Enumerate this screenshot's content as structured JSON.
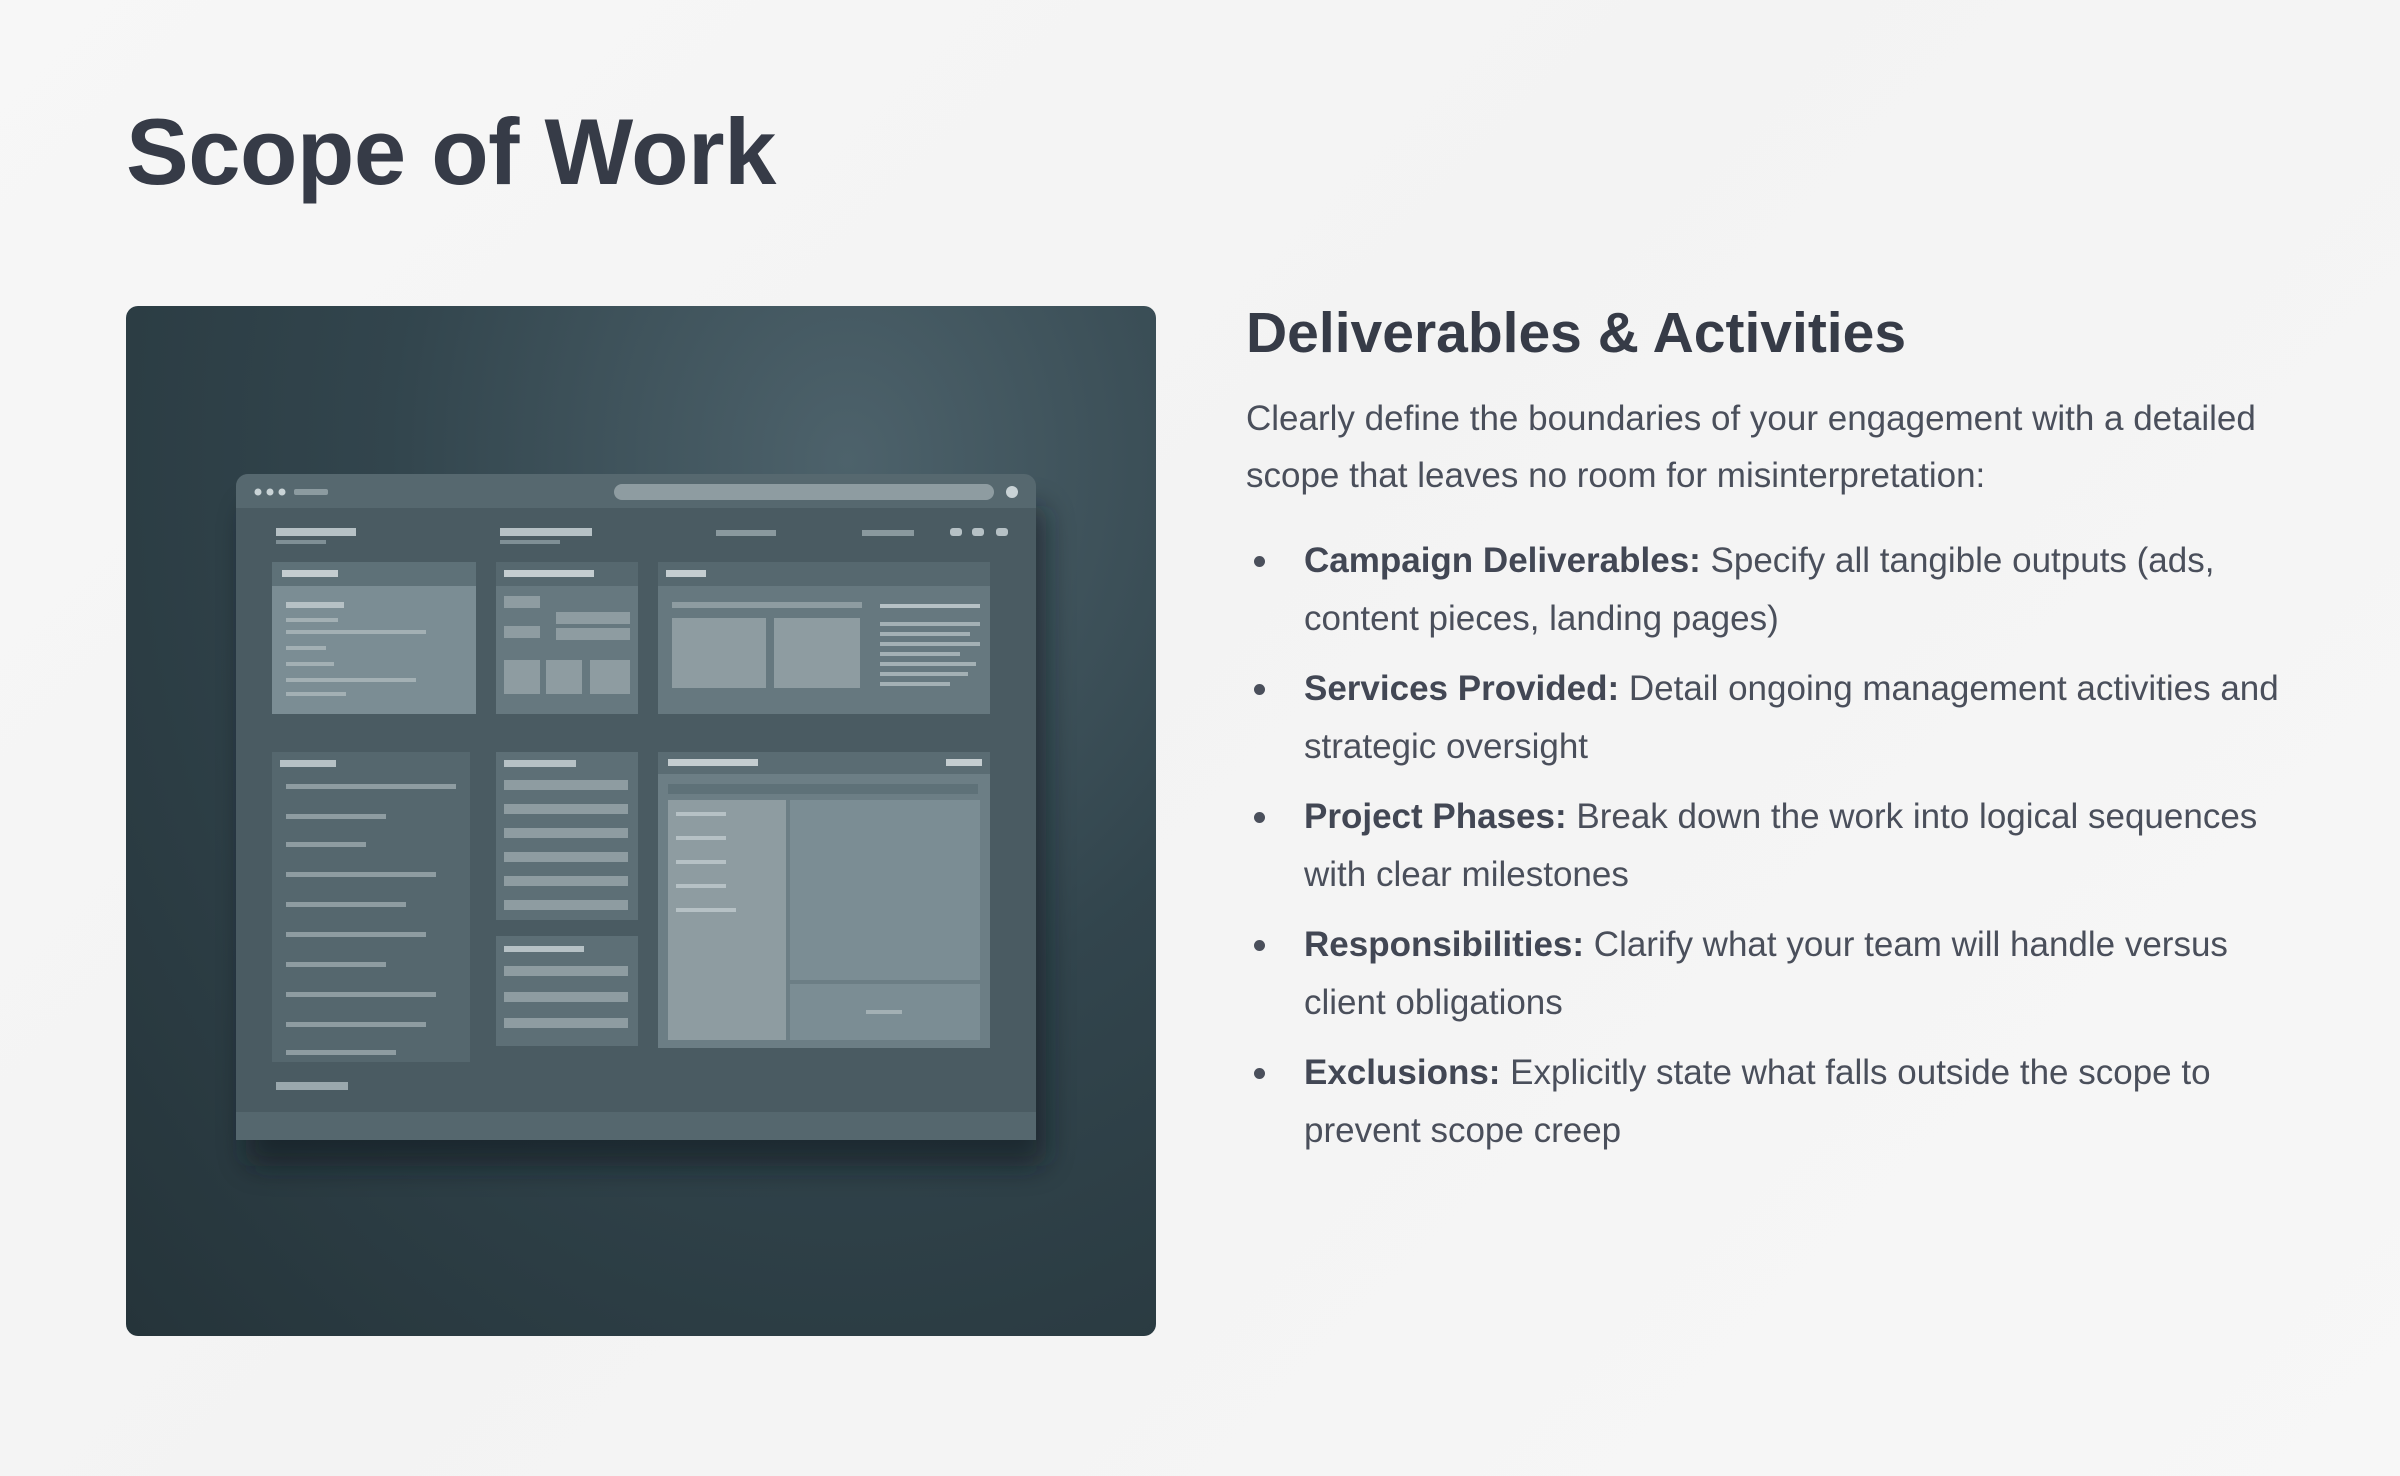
{
  "slide": {
    "title": "Scope of Work"
  },
  "content": {
    "heading": "Deliverables & Activities",
    "intro": "Clearly define the boundaries of your engagement with a detailed scope that leaves no room for misinterpretation:",
    "bullets": [
      {
        "term": "Campaign Deliverables:",
        "text": " Specify all tangible outputs (ads, content pieces, landing pages)"
      },
      {
        "term": "Services Provided:",
        "text": " Detail ongoing management activities and strategic oversight"
      },
      {
        "term": "Project Phases:",
        "text": " Break down the work into logical sequences with clear milestones"
      },
      {
        "term": "Responsibilities:",
        "text": " Clarify what your team will handle versus client obligations"
      },
      {
        "term": "Exclusions:",
        "text": " Explicitly state what falls outside the scope to prevent scope creep"
      }
    ]
  },
  "colors": {
    "text_primary": "#363b47",
    "text_body": "#4a4f5b",
    "illustration_bg": "#32454d",
    "page_bg": "#f5f5f5"
  }
}
